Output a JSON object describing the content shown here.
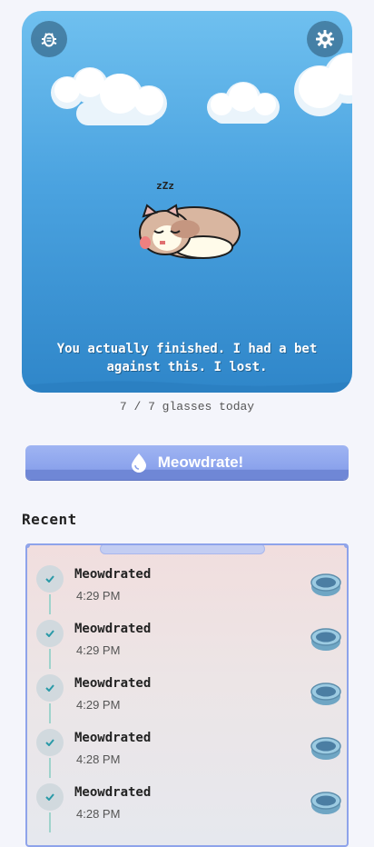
{
  "scene": {
    "message": "You actually finished. I had a bet against this. I lost.",
    "sleep_text": "zZz",
    "bug_icon": "bug-icon",
    "settings_icon": "gear-icon",
    "sky_color": "#4ba3e0"
  },
  "progress": {
    "text": "7 / 7 glasses today",
    "done": 7,
    "goal": 7
  },
  "action": {
    "label": "Meowdrate!",
    "icon": "water-drop-icon",
    "color": "#8aa2ec"
  },
  "recent": {
    "title": "Recent",
    "items": [
      {
        "label": "Meowdrated",
        "time": "4:29 PM"
      },
      {
        "label": "Meowdrated",
        "time": "4:29 PM"
      },
      {
        "label": "Meowdrated",
        "time": "4:29 PM"
      },
      {
        "label": "Meowdrated",
        "time": "4:28 PM"
      },
      {
        "label": "Meowdrated",
        "time": "4:28 PM"
      }
    ]
  }
}
